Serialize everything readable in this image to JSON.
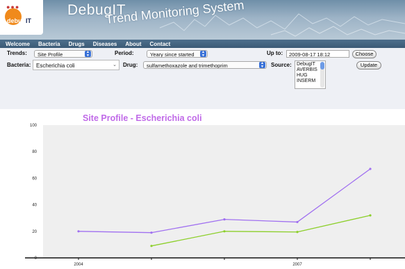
{
  "app": {
    "logo_text_pre": "debug",
    "logo_text_post": "IT",
    "title": "DebugIT",
    "subtitle": "Trend Monitoring System"
  },
  "nav": {
    "items": [
      {
        "label": "Welcome"
      },
      {
        "label": "Bacteria"
      },
      {
        "label": "Drugs"
      },
      {
        "label": "Diseases"
      },
      {
        "label": "About"
      },
      {
        "label": "Contact"
      }
    ]
  },
  "controls": {
    "trends_label": "Trends:",
    "trends_value": "Site Profile",
    "bacteria_label": "Bacteria:",
    "bacteria_value": "Escherichia coli",
    "period_label": "Period:",
    "period_value": "Yeary since started",
    "drug_label": "Drug:",
    "drug_value": "sulfamethoxazole and trimethoprim",
    "upto_label": "Up to:",
    "upto_value": "2009-08-17 18:12",
    "choose_button": "Choose",
    "source_label": "Source:",
    "source_options": [
      "DebugIT",
      "AVERBIS",
      "HUG",
      "INSERM"
    ],
    "update_button": "Update"
  },
  "chart_data": {
    "type": "line",
    "title": "Site Profile - Escherichia coli",
    "xlabel": "",
    "ylabel": "",
    "x": [
      2004,
      2005,
      2006,
      2007,
      2008
    ],
    "x_tick_labels": [
      "2004",
      "",
      "",
      "2007",
      ""
    ],
    "ylim": [
      0,
      100
    ],
    "y_ticks": [
      0,
      20,
      40,
      60,
      80,
      100
    ],
    "series": [
      {
        "color": "#a070f0",
        "points": [
          [
            2004,
            20
          ],
          [
            2005,
            19
          ],
          [
            2006,
            29
          ],
          [
            2007,
            27
          ],
          [
            2008,
            67
          ]
        ]
      },
      {
        "color": "#8ccf2a",
        "points": [
          [
            2005,
            9
          ],
          [
            2006,
            20
          ],
          [
            2007,
            19.5
          ],
          [
            2008,
            32
          ]
        ]
      }
    ],
    "grid": false,
    "background": "#efefef"
  }
}
